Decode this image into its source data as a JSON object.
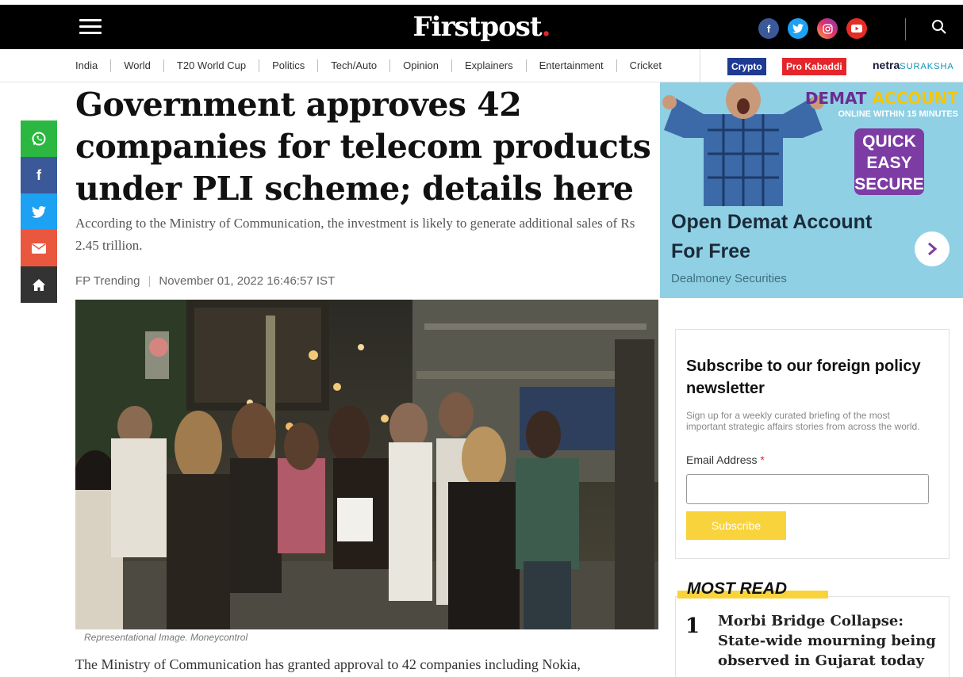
{
  "header": {
    "logo_text": "Firstpost",
    "logo_dot": ".",
    "socials": [
      "facebook-icon",
      "twitter-icon",
      "instagram-icon",
      "youtube-icon"
    ]
  },
  "nav": {
    "items": [
      "India",
      "World",
      "T20 World Cup",
      "Politics",
      "Tech/Auto",
      "Opinion",
      "Explainers",
      "Entertainment",
      "Cricket"
    ],
    "crypto": "Crypto",
    "kabaddi": "Pro Kabaddi",
    "netra_bold": "netra",
    "netra_rest": "SURAKSHA"
  },
  "share": [
    "whatsapp-icon",
    "facebook-icon",
    "twitter-icon",
    "mail-icon",
    "home-icon"
  ],
  "article": {
    "headline": "Government approves 42 companies for telecom products under PLI scheme; details here",
    "subhead": "According to the Ministry of Communication, the investment is likely to generate additional sales of Rs 2.45 trillion.",
    "author": "FP Trending",
    "date": "November 01, 2022 16:46:57 IST",
    "caption": "Representational Image. Moneycontrol",
    "body_first_line": "The Ministry of Communication has granted approval to 42 companies including Nokia,"
  },
  "ad": {
    "demat": "DEMAT",
    "account": "ACCOUNT",
    "online": "ONLINE WITHIN 15 MINUTES",
    "quick": "QUICK",
    "easy": "EASY",
    "secure": "SECURE",
    "title_line1": "Open Demat Account",
    "title_line2": "For Free",
    "sponsor": "Dealmoney Securities"
  },
  "newsletter": {
    "title": "Subscribe to our foreign policy newsletter",
    "description": "Sign up for a weekly curated briefing of the most important strategic affairs stories from across the world.",
    "email_label": "Email Address",
    "required_mark": "*",
    "email_value": "",
    "button": "Subscribe"
  },
  "most_read": {
    "header": "MOST READ",
    "items": [
      {
        "rank": "1",
        "title": "Morbi Bridge Collapse: State-wide mourning being observed in Gujarat today"
      }
    ]
  },
  "colors": {
    "topbar": "#000000",
    "brand_red": "#e4262b",
    "subscribe_yellow": "#f9d33b",
    "ad_bg": "#8fd0e4"
  }
}
